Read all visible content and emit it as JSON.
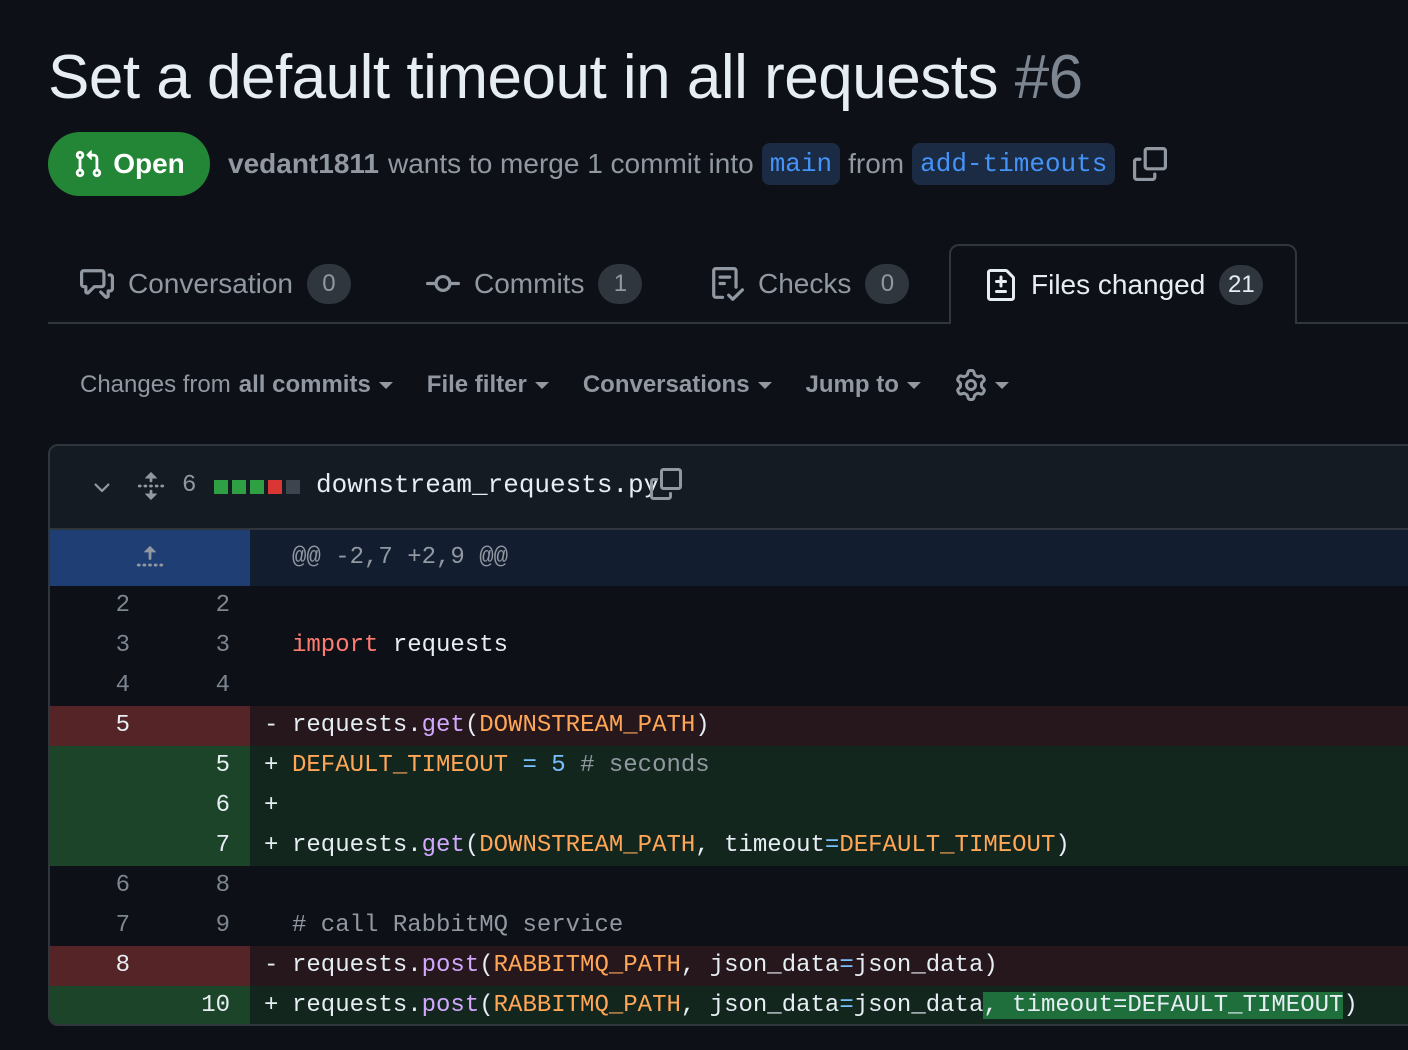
{
  "pr": {
    "title": "Set a default timeout in all requests",
    "number": "#6",
    "state": "Open",
    "author": "vedant1811",
    "merge_text": "wants to merge 1 commit into",
    "base_branch": "main",
    "from_text": "from",
    "head_branch": "add-timeouts"
  },
  "tabs": [
    {
      "label": "Conversation",
      "count": "0",
      "icon": "comment-discussion-icon"
    },
    {
      "label": "Commits",
      "count": "1",
      "icon": "git-commit-icon"
    },
    {
      "label": "Checks",
      "count": "0",
      "icon": "checklist-icon"
    },
    {
      "label": "Files changed",
      "count": "21",
      "icon": "file-diff-icon",
      "active": true
    }
  ],
  "toolbar": {
    "changes_prefix": "Changes from",
    "changes_value": "all commits",
    "file_filter": "File filter",
    "conversations": "Conversations",
    "jump_to": "Jump to"
  },
  "file": {
    "changes": "6",
    "name": "downstream_requests.py",
    "diffstat": [
      "add",
      "add",
      "add",
      "del",
      "neutral"
    ],
    "hunk": "@@ -2,7 +2,9 @@"
  },
  "lines": {
    "l1": {
      "old": "2",
      "new": "2"
    },
    "l2": {
      "old": "3",
      "new": "3",
      "kw": "import",
      "rest": " requests"
    },
    "l3": {
      "old": "4",
      "new": "4"
    },
    "l4": {
      "old": "5",
      "new": "",
      "sign": "-",
      "obj": "requests.",
      "fn": "get",
      "p1": "(",
      "c1": "DOWNSTREAM_PATH",
      "p2": ")"
    },
    "l5": {
      "old": "",
      "new": "5",
      "sign": "+",
      "c1": "DEFAULT_TIMEOUT",
      "sp": " ",
      "op": "=",
      "sp2": " ",
      "num": "5",
      "cm": " # seconds"
    },
    "l6": {
      "old": "",
      "new": "6",
      "sign": "+"
    },
    "l7": {
      "old": "",
      "new": "7",
      "sign": "+",
      "obj": "requests.",
      "fn": "get",
      "p1": "(",
      "c1": "DOWNSTREAM_PATH",
      "p2": ", timeout",
      "op": "=",
      "c2": "DEFAULT_TIMEOUT",
      "p3": ")"
    },
    "l8": {
      "old": "6",
      "new": "8"
    },
    "l9": {
      "old": "7",
      "new": "9",
      "cm": "# call RabbitMQ service"
    },
    "l10": {
      "old": "8",
      "new": "",
      "sign": "-",
      "obj": "requests.",
      "fn": "post",
      "p1": "(",
      "c1": "RABBITMQ_PATH",
      "p2": ", json_data",
      "op": "=",
      "p3": "json_data)"
    },
    "l11": {
      "old": "",
      "new": "10",
      "sign": "+",
      "obj": "requests.",
      "fn": "post",
      "p1": "(",
      "c1": "RABBITMQ_PATH",
      "p2": ", json_data",
      "op": "=",
      "p3": "json_data",
      "hl": ", timeout=DEFAULT_TIMEOUT",
      "p4": ")"
    }
  },
  "colors": {
    "open_badge": "#238636",
    "add": "#2ea043",
    "del": "#da3633",
    "link": "#4493f8"
  }
}
